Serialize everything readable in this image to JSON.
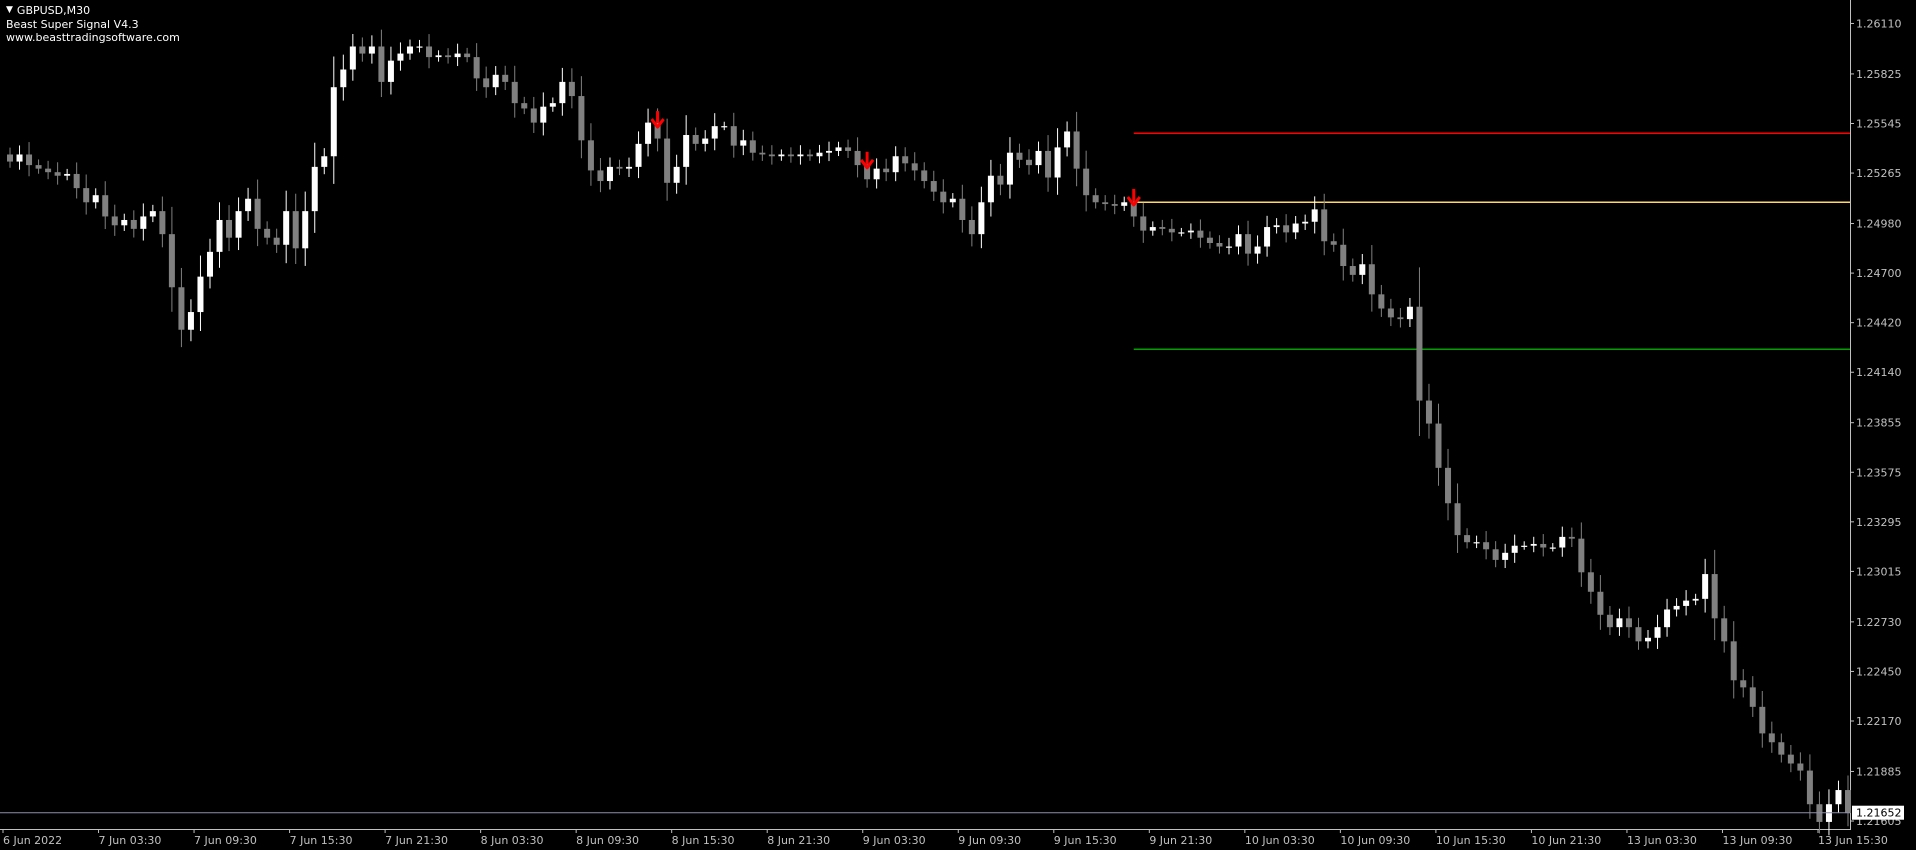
{
  "header": {
    "symbol": "GBPUSD,M30",
    "indicator": "Beast Super Signal V4.3",
    "website": "www.beasttradingsoftware.com"
  },
  "colors": {
    "background": "#000000",
    "bull_candle": "#ffffff",
    "bear_candle": "#808080",
    "axis": "#c0c0c0",
    "signal_arrow": "#ff0000",
    "stop_line": "#ff0000",
    "entry_line": "#ffd966",
    "target_line": "#00a000",
    "bid_line": "#8a8fa8"
  },
  "chart_data": {
    "type": "candlestick",
    "timeframe": "M30",
    "y_ticks": [
      "1.26110",
      "1.25825",
      "1.25545",
      "1.25265",
      "1.24980",
      "1.24700",
      "1.24420",
      "1.24140",
      "1.23855",
      "1.23575",
      "1.23295",
      "1.23015",
      "1.22730",
      "1.22450",
      "1.22170",
      "1.21885",
      "1.21605"
    ],
    "x_ticks": [
      "6 Jun 2022",
      "7 Jun 03:30",
      "7 Jun 09:30",
      "7 Jun 15:30",
      "7 Jun 21:30",
      "8 Jun 03:30",
      "8 Jun 09:30",
      "8 Jun 15:30",
      "8 Jun 21:30",
      "9 Jun 03:30",
      "9 Jun 09:30",
      "9 Jun 15:30",
      "9 Jun 21:30",
      "10 Jun 03:30",
      "10 Jun 09:30",
      "10 Jun 15:30",
      "10 Jun 21:30",
      "13 Jun 03:30",
      "13 Jun 09:30",
      "13 Jun 15:30"
    ],
    "ylim": [
      1.2156,
      1.2622
    ],
    "current_price": "1.21652",
    "levels": {
      "stop": 1.2549,
      "entry": 1.251,
      "target": 1.2427
    },
    "sell_signal_bars": [
      68,
      90,
      118
    ],
    "closes": [
      1.2533,
      1.2537,
      1.2531,
      1.2529,
      1.2527,
      1.2525,
      1.2526,
      1.2518,
      1.251,
      1.2514,
      1.2502,
      1.2497,
      1.25,
      1.2495,
      1.2502,
      1.2505,
      1.2492,
      1.2462,
      1.2438,
      1.2448,
      1.2468,
      1.2482,
      1.25,
      1.249,
      1.2505,
      1.2512,
      1.2495,
      1.249,
      1.2486,
      1.2505,
      1.2484,
      1.2505,
      1.253,
      1.2536,
      1.2575,
      1.2585,
      1.2598,
      1.2594,
      1.2598,
      1.2578,
      1.259,
      1.2594,
      1.2598,
      1.2598,
      1.2592,
      1.2593,
      1.2592,
      1.2594,
      1.2592,
      1.258,
      1.2575,
      1.2582,
      1.2578,
      1.2566,
      1.2563,
      1.2555,
      1.2564,
      1.2566,
      1.2578,
      1.257,
      1.2545,
      1.2528,
      1.2522,
      1.253,
      1.2529,
      1.253,
      1.2543,
      1.2555,
      1.2546,
      1.2521,
      1.253,
      1.2548,
      1.2543,
      1.2546,
      1.2553,
      1.2553,
      1.2542,
      1.2545,
      1.2538,
      1.2537,
      1.2536,
      1.2537,
      1.2536,
      1.2537,
      1.2536,
      1.2538,
      1.2539,
      1.2541,
      1.2539,
      1.2531,
      1.2523,
      1.2529,
      1.2527,
      1.2536,
      1.2532,
      1.2528,
      1.2522,
      1.2516,
      1.251,
      1.2512,
      1.25,
      1.2492,
      1.251,
      1.2525,
      1.252,
      1.2538,
      1.2534,
      1.2531,
      1.2539,
      1.2524,
      1.2541,
      1.255,
      1.2529,
      1.2514,
      1.251,
      1.2509,
      1.2508,
      1.251,
      1.2502,
      1.2494,
      1.2496,
      1.2495,
      1.2493,
      1.2493,
      1.2494,
      1.249,
      1.2487,
      1.2485,
      1.2485,
      1.2492,
      1.2481,
      1.2485,
      1.2496,
      1.2497,
      1.2493,
      1.2498,
      1.2499,
      1.2506,
      1.2488,
      1.2486,
      1.2474,
      1.2469,
      1.2475,
      1.2458,
      1.245,
      1.2445,
      1.2444,
      1.2451,
      1.2398,
      1.2385,
      1.236,
      1.234,
      1.2322,
      1.2318,
      1.2318,
      1.2314,
      1.2308,
      1.2312,
      1.2316,
      1.2316,
      1.2317,
      1.2315,
      1.2315,
      1.2321,
      1.232,
      1.2301,
      1.229,
      1.2277,
      1.227,
      1.2275,
      1.227,
      1.2262,
      1.2264,
      1.227,
      1.228,
      1.2282,
      1.2285,
      1.2286,
      1.23,
      1.2275,
      1.2262,
      1.224,
      1.2236,
      1.2225,
      1.221,
      1.2205,
      1.2198,
      1.2193,
      1.2189,
      1.217,
      1.216,
      1.217,
      1.2178,
      1.2165
    ]
  }
}
